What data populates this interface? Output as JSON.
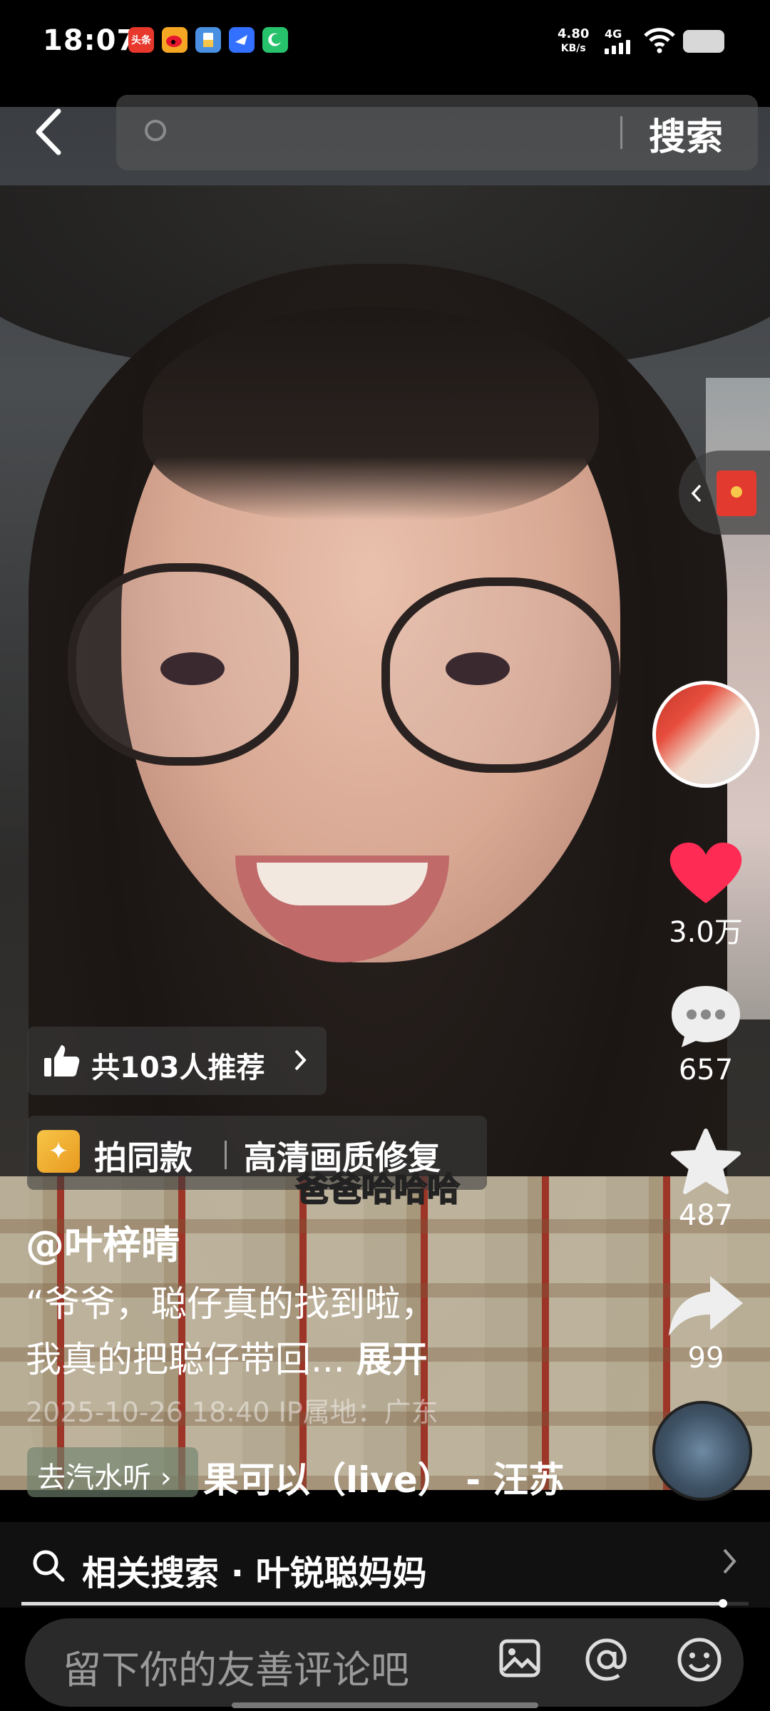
{
  "status_bar": {
    "time": "18:07",
    "net_speed_value": "4.80",
    "net_speed_unit": "KB/s",
    "network": "4G",
    "app_badges": [
      {
        "name": "toutiao-icon",
        "text": "头条",
        "bg": "#e8372b"
      },
      {
        "name": "weibo-icon",
        "text": "",
        "bg": "#f5a623"
      },
      {
        "name": "files-icon",
        "text": "",
        "bg": "#4a90e2"
      },
      {
        "name": "feishu-icon",
        "text": "",
        "bg": "#3370ff"
      },
      {
        "name": "phone-icon",
        "text": "",
        "bg": "#27c26c"
      }
    ]
  },
  "search": {
    "button_label": "搜索"
  },
  "rail": {
    "likes": "3.0万",
    "comments": "657",
    "favorites": "487",
    "shares": "99"
  },
  "recommend": {
    "label": "共103人推荐"
  },
  "tools": {
    "same_style": "拍同款",
    "hd_repair": "高清画质修复"
  },
  "video_subtitle": "爸爸哈哈哈",
  "post": {
    "author": "@叶梓晴",
    "desc_line1": "“爷爷，聪仔真的找到啦，",
    "desc_line2": "我真的把聪仔带回... ",
    "expand": "展开",
    "meta": "2025-10-26 18:40  IP属地：广东"
  },
  "music": {
    "go_label": "去汽水听",
    "title": "果可以（live） - 汪苏"
  },
  "related": {
    "label": "相关搜索 · 叶锐聪妈妈"
  },
  "progress": 0.965,
  "comment": {
    "placeholder": "留下你的友善评论吧"
  },
  "colors": {
    "like": "#fe2c55",
    "background": "#000000"
  }
}
